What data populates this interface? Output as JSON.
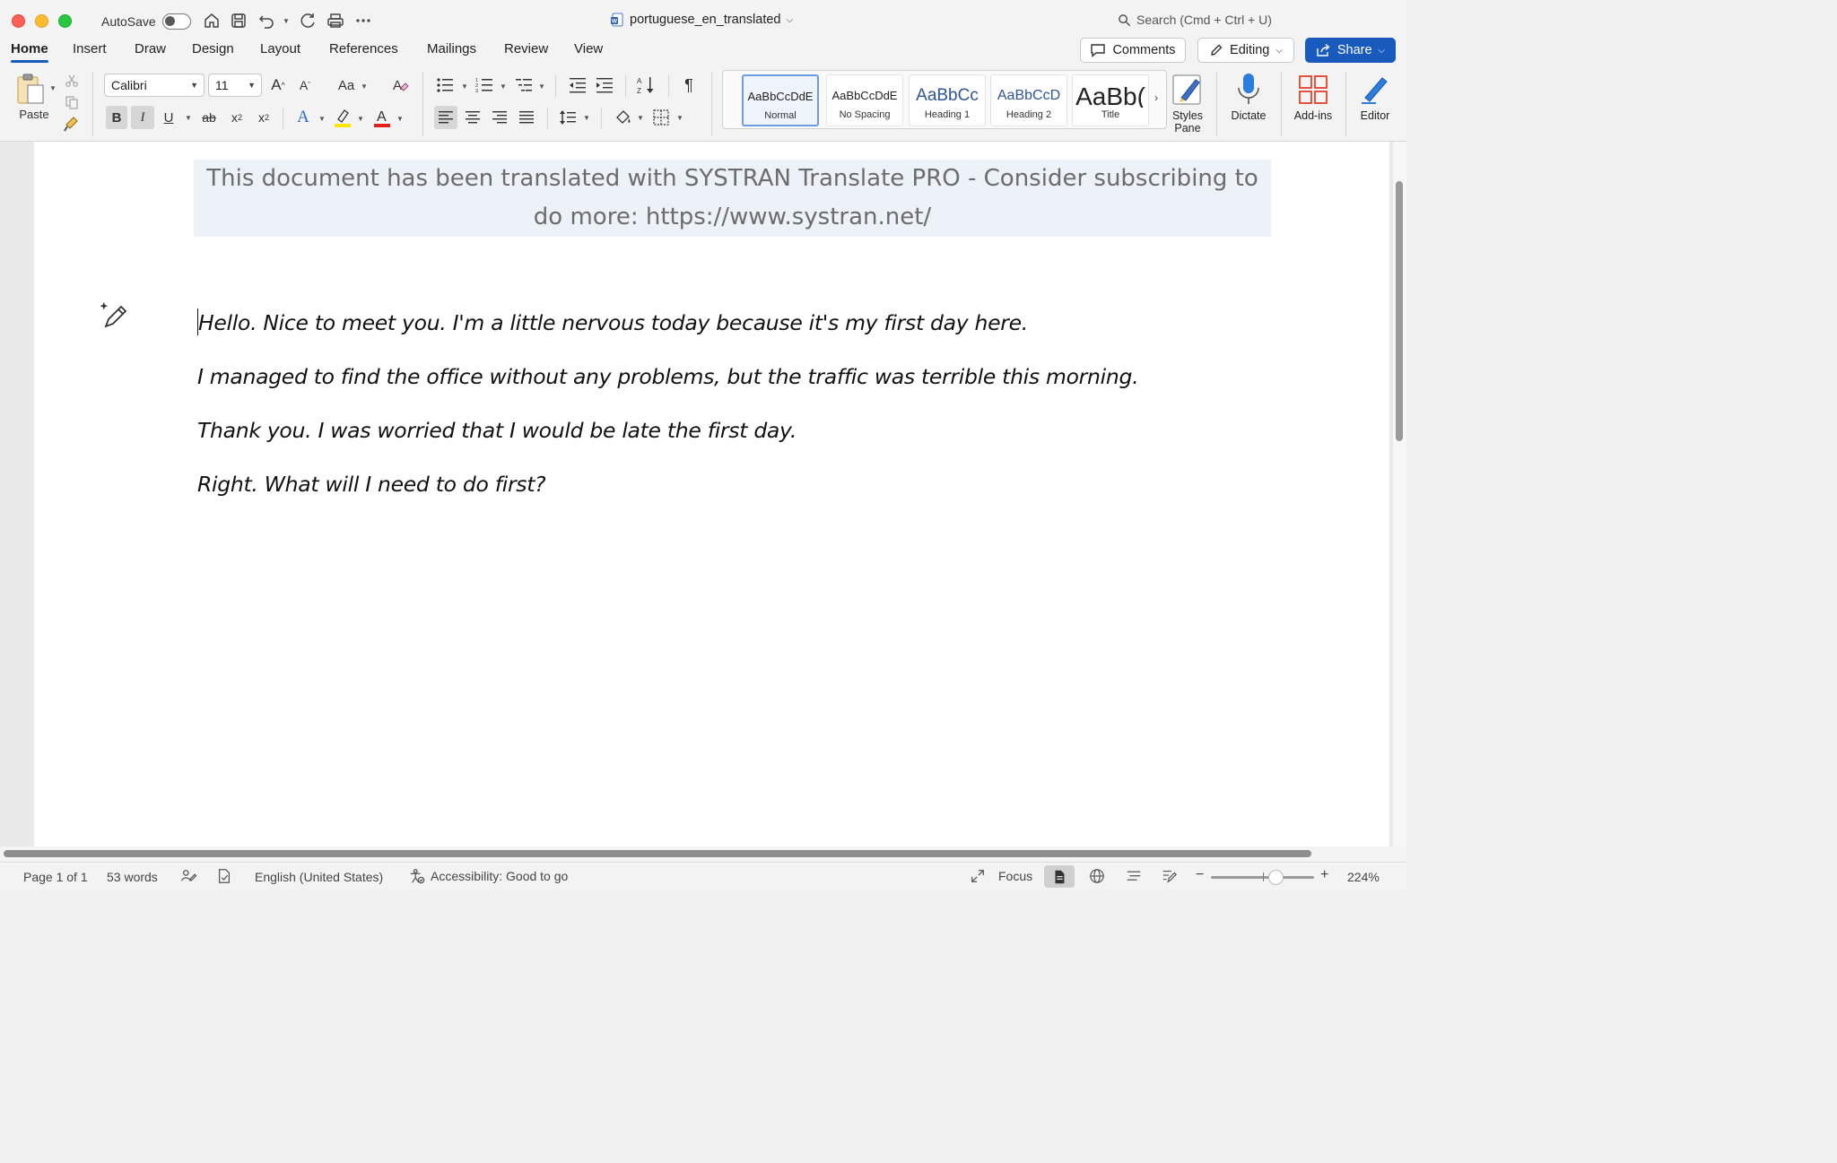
{
  "titlebar": {
    "autosave_label": "AutoSave",
    "doc_title": "portuguese_en_translated",
    "search_placeholder": "Search (Cmd + Ctrl + U)"
  },
  "ribbon_tabs": [
    "Home",
    "Insert",
    "Draw",
    "Design",
    "Layout",
    "References",
    "Mailings",
    "Review",
    "View"
  ],
  "active_tab": "Home",
  "actions": {
    "comments_label": "Comments",
    "editing_label": "Editing",
    "share_label": "Share"
  },
  "clipboard": {
    "paste_label": "Paste"
  },
  "font": {
    "name": "Calibri",
    "size": "11"
  },
  "format_buttons": {
    "bold": "B",
    "italic": "I",
    "underline": "U",
    "strike": "ab",
    "grow": "A",
    "shrink": "A",
    "change_case": "Aa",
    "text_effects": "A",
    "font_color": "A",
    "subscript": "x",
    "superscript": "x"
  },
  "styles": [
    {
      "sample": "AaBbCcDdE",
      "name": "Normal",
      "selected": true
    },
    {
      "sample": "AaBbCcDdE",
      "name": "No Spacing",
      "selected": false
    },
    {
      "sample": "AaBbCc",
      "name": "Heading 1",
      "selected": false
    },
    {
      "sample": "AaBbCcD",
      "name": "Heading 2",
      "selected": false
    },
    {
      "sample": "AaBb(",
      "name": "Title",
      "selected": false
    }
  ],
  "big_buttons": {
    "styles_pane": "Styles Pane",
    "dictate": "Dictate",
    "addins": "Add-ins",
    "editor": "Editor"
  },
  "document": {
    "banner": "This document has been translated with SYSTRAN Translate PRO - Consider subscribing to do more: https://www.systran.net/",
    "lines": [
      "Hello. Nice to meet you. I'm a little nervous today because it's my first day here.",
      "I managed to find the office without any problems, but the traffic was terrible this morning.",
      "Thank you. I was worried that I would be late the first day.",
      "Right. What will I need to do first?"
    ]
  },
  "statusbar": {
    "page": "Page 1 of 1",
    "words": "53 words",
    "language": "English (United States)",
    "accessibility": "Accessibility: Good to go",
    "focus": "Focus",
    "zoom_minus": "−",
    "zoom_plus": "+",
    "zoom": "224%"
  },
  "colors": {
    "accent": "#185abd",
    "highlight": "#ffe600",
    "font_color_bar": "#e0201b",
    "banner_bg": "#ecf2f8"
  }
}
